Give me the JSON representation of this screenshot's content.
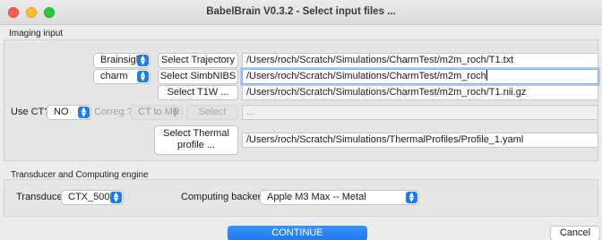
{
  "window": {
    "title": "BabelBrain V0.3.2 - Select input files ..."
  },
  "imaging": {
    "group_label": "Imaging input",
    "navigation_select": "Brainsight",
    "select_trajectory_label": "Select Trajectory ...",
    "trajectory_path": "/Users/roch/Scratch/Simulations/CharmTest/m2m_roch/T1.txt",
    "segmentation_select": "charm",
    "select_simbnibs_label": "Select SimbNIBS ...",
    "simbnibs_path": "/Users/roch/Scratch/Simulations/CharmTest/m2m_roch",
    "select_t1w_label": "Select T1W ...",
    "t1w_path": "/Users/roch/Scratch/Simulations/CharmTest/m2m_roch/T1.nii.gz",
    "use_ct_label": "Use CT?",
    "use_ct_value": "NO",
    "coreg_label": "Correg.?",
    "coreg_value": "CT to MR",
    "ct_select_label": "Select",
    "ct_path": "...",
    "select_thermal_label": "Select Thermal profile ...",
    "thermal_path": "/Users/roch/Scratch/Simulations/ThermalProfiles/Profile_1.yaml"
  },
  "engine": {
    "group_label": "Transducer and Computing engine",
    "transducer_label": "Transducer",
    "transducer_value": "CTX_500",
    "backend_label": "Computing backend",
    "backend_value": "Apple M3 Max -- Metal"
  },
  "footer": {
    "continue_label": "CONTINUE",
    "cancel_label": "Cancel"
  },
  "colors": {
    "accent": "#1e78f0",
    "focus_ring": "#aacbf5"
  },
  "icons": {
    "popup_indicator": "updown-chevron-icon"
  }
}
